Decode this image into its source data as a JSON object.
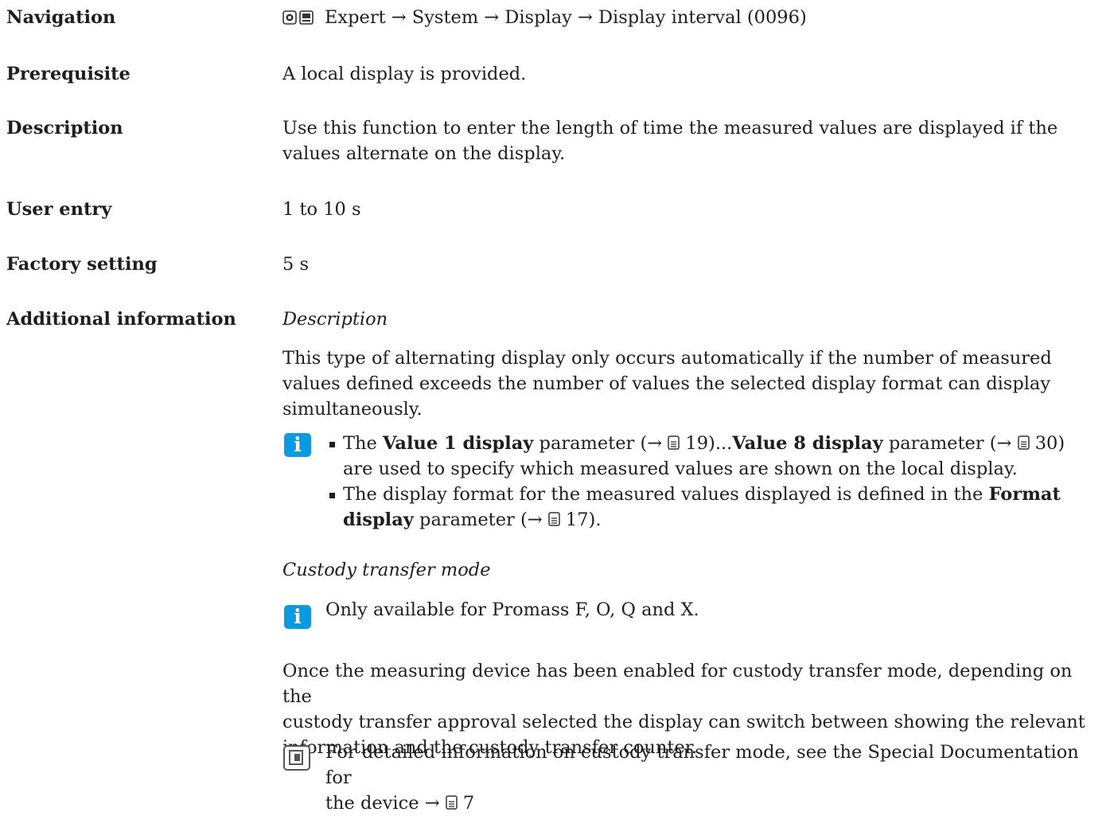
{
  "navigation": {
    "label": "Navigation",
    "path": "Expert → System → Display → Display interval (0096)"
  },
  "prerequisite": {
    "label": "Prerequisite",
    "text": "A local display is provided."
  },
  "description": {
    "label": "Description",
    "line1": "Use this function to enter the length of time the measured values are displayed if the",
    "line2": "values alternate on the display."
  },
  "user_entry": {
    "label": "User entry",
    "value": "1 to 10 s"
  },
  "factory_setting": {
    "label": "Factory setting",
    "value": "5 s"
  },
  "additional": {
    "label": "Additional information",
    "desc_heading": "Description",
    "para1": [
      "This type of alternating display only occurs automatically if the number of measured",
      "values defined exceeds the number of values the selected display format can display",
      "simultaneously."
    ],
    "bullet1": {
      "the": "The",
      "value1": "Value 1 display",
      "param_arrow": "parameter (→",
      "page19": "19)...",
      "value8": "Value 8 display",
      "param_arrow2": "parameter (→",
      "page30": "30)",
      "line2": "are used to specify which measured values are shown on the local display."
    },
    "bullet2": {
      "line1_start": "The display format for the measured values displayed is defined in the",
      "format": "Format",
      "display": "display",
      "param_arrow": "parameter (→",
      "page17": "17)."
    },
    "custody_heading": "Custody transfer mode",
    "custody_note": "Only available for Promass F, O, Q and X.",
    "para2": [
      "Once the measuring device has been enabled for custody transfer mode, depending on the",
      "custody transfer approval selected the display can switch between showing the relevant",
      "information and the custody transfer counter."
    ],
    "book_note": {
      "line1": "For detailed information on custody transfer mode, see the Special Documentation for",
      "line2": "the device →",
      "page": "7"
    }
  },
  "colors": {
    "info_blue": "#0a9adf",
    "text": "#1e1e1e"
  }
}
